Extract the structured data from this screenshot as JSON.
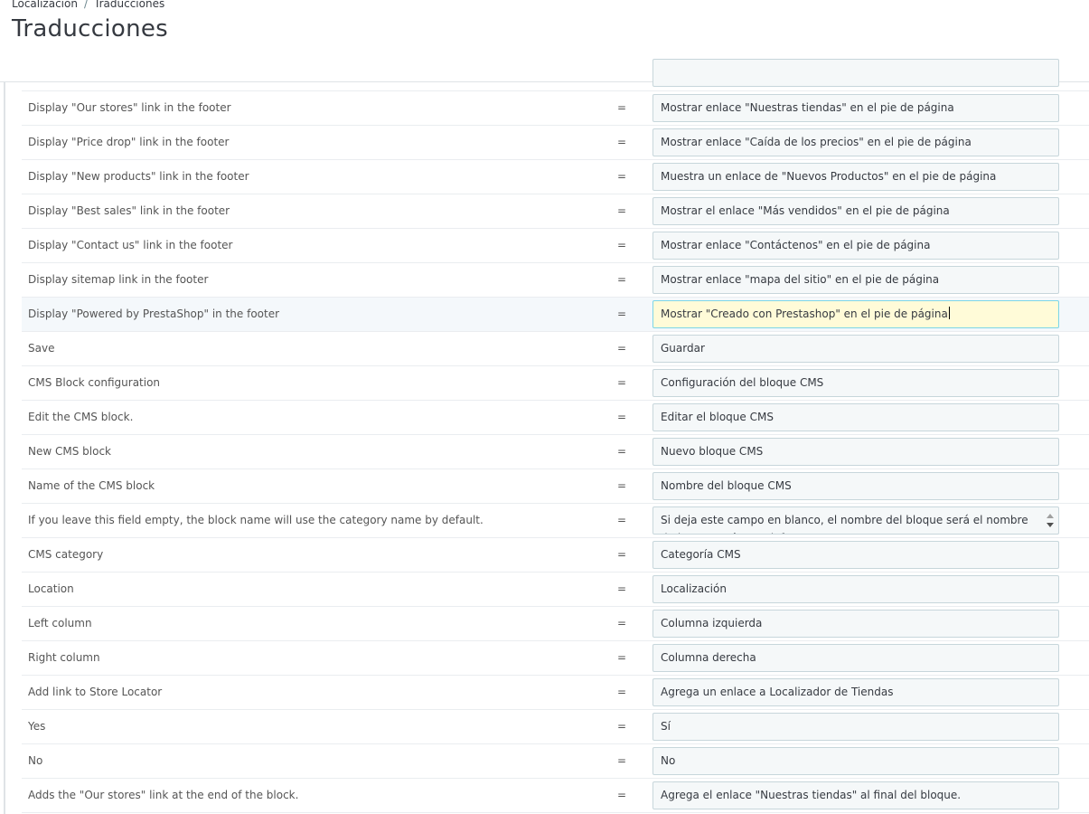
{
  "breadcrumb": {
    "items": [
      "Localización",
      "Traducciones"
    ],
    "separator": "/"
  },
  "page_title": "Traducciones",
  "rows": [
    {
      "source": "",
      "translation": ""
    },
    {
      "source": "Display \"Our stores\" link in the footer",
      "translation": "Mostrar enlace \"Nuestras tiendas\" en el pie de página"
    },
    {
      "source": "Display \"Price drop\" link in the footer",
      "translation": "Mostrar enlace \"Caída de los precios\" en el pie de página"
    },
    {
      "source": "Display \"New products\" link in the footer",
      "translation": "Muestra un enlace de \"Nuevos Productos\" en el pie de página"
    },
    {
      "source": "Display \"Best sales\" link in the footer",
      "translation": "Mostrar el enlace \"Más vendidos\" en el pie de página"
    },
    {
      "source": "Display \"Contact us\" link in the footer",
      "translation": "Mostrar enlace \"Contáctenos\" en el pie de página"
    },
    {
      "source": "Display sitemap link in the footer",
      "translation": "Mostrar enlace \"mapa del sitio\" en el pie de página"
    },
    {
      "source": "Display \"Powered by PrestaShop\" in the footer",
      "translation": "Mostrar \"Creado con Prestashop\" en el pie de página"
    },
    {
      "source": "Save",
      "translation": "Guardar"
    },
    {
      "source": "CMS Block configuration",
      "translation": "Configuración del bloque CMS"
    },
    {
      "source": "Edit the CMS block.",
      "translation": "Editar el bloque CMS"
    },
    {
      "source": "New CMS block",
      "translation": "Nuevo bloque CMS"
    },
    {
      "source": "Name of the CMS block",
      "translation": "Nombre del bloque CMS"
    },
    {
      "source": "If you leave this field empty, the block name will use the category name by default.",
      "translation": "Si deja este campo en blanco, el nombre del bloque será el nombre de la categoría por defecto."
    },
    {
      "source": "CMS category",
      "translation": "Categoría CMS"
    },
    {
      "source": "Location",
      "translation": "Localización"
    },
    {
      "source": "Left column",
      "translation": "Columna izquierda"
    },
    {
      "source": "Right column",
      "translation": "Columna derecha"
    },
    {
      "source": "Add link to Store Locator",
      "translation": "Agrega un enlace a Localizador de Tiendas"
    },
    {
      "source": "Yes",
      "translation": "Sí"
    },
    {
      "source": "No",
      "translation": "No"
    },
    {
      "source": "Adds the \"Our stores\" link at the end of the block.",
      "translation": "Agrega el enlace \"Nuestras tiendas\" al final del bloque."
    }
  ],
  "equals_sign": "=",
  "colors": {
    "focused_field": "#fffbd8",
    "active_row": "#f4f8fb",
    "field_bg": "#f5f8f9"
  }
}
